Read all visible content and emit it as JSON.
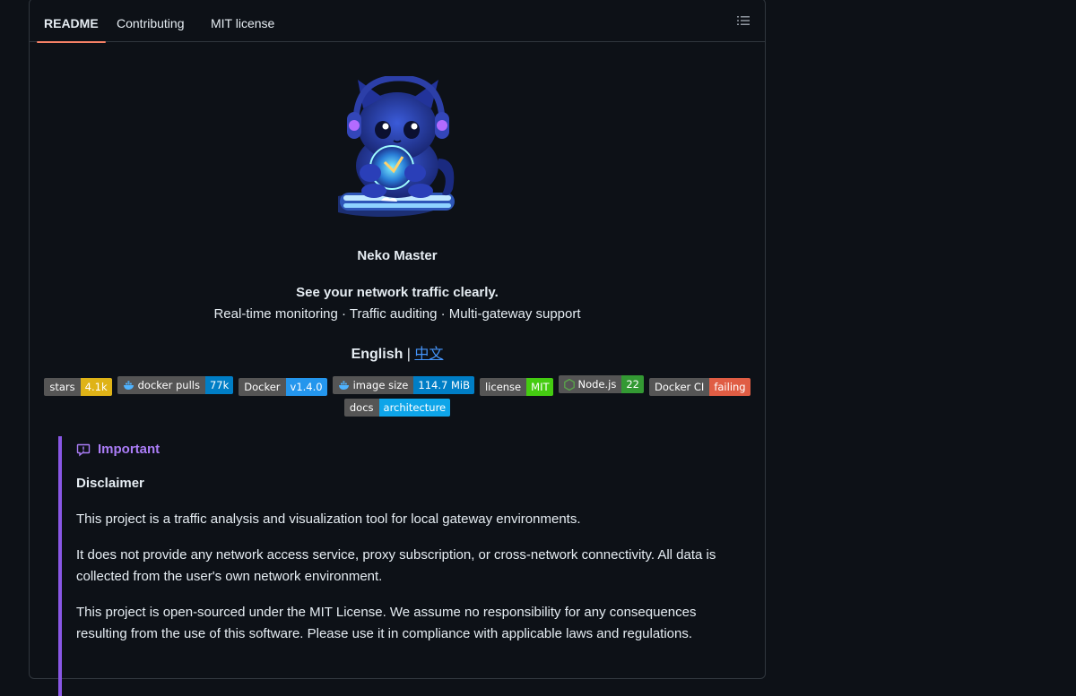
{
  "tabs": [
    {
      "label": "README"
    },
    {
      "label": "Contributing"
    },
    {
      "label": "MIT license"
    }
  ],
  "readme": {
    "title": "Neko Master",
    "tagline": "See your network traffic clearly.",
    "features": "Real-time monitoring · Traffic auditing · Multi-gateway support",
    "lang_current": "English",
    "lang_sep": " | ",
    "lang_other": "中文",
    "badges": [
      {
        "label": "stars",
        "value": "4.1k",
        "color": "#dfb317"
      },
      {
        "label": "docker pulls",
        "value": "77k",
        "color": "#007ec6",
        "icon": "docker-icon"
      },
      {
        "label": "Docker",
        "value": "v1.4.0",
        "color": "#2496ed"
      },
      {
        "label": "image size",
        "value": "114.7 MiB",
        "color": "#007ec6",
        "icon": "docker-icon"
      },
      {
        "label": "license",
        "value": "MIT",
        "color": "#4c1"
      },
      {
        "label": "Node.js",
        "value": "22",
        "color": "#339933",
        "icon": "nodejs-icon"
      },
      {
        "label": "Docker CI",
        "value": "failing",
        "color": "#e05d44"
      }
    ],
    "badges2": [
      {
        "label": "docs",
        "value": "architecture",
        "color": "#0ea5e9"
      }
    ],
    "callout": {
      "heading": "Important",
      "subheading": "Disclaimer",
      "p1": "This project is a traffic analysis and visualization tool for local gateway environments.",
      "p2": "It does not provide any network access service, proxy subscription, or cross-network connectivity. All data is collected from the user's own network environment.",
      "p3": "This project is open-sourced under the MIT License. We assume no responsibility for any consequences resulting from the use of this software. Please use it in compliance with applicable laws and regulations."
    }
  },
  "colors": {
    "accent_tab": "#f78166",
    "callout_important": "#8957e5",
    "link": "#4493f8"
  }
}
